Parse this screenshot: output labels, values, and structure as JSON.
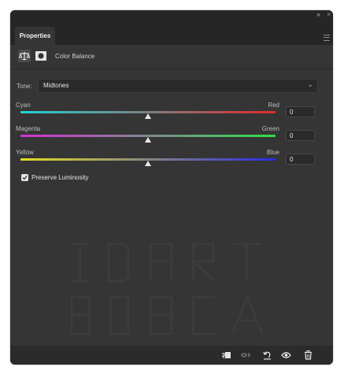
{
  "panel": {
    "tab_label": "Properties",
    "collapse_glyph": "«",
    "close_glyph": "×"
  },
  "header": {
    "adjustment_title": "Color Balance",
    "icons": [
      "balance-scale-icon",
      "layer-mask-icon"
    ]
  },
  "tone": {
    "label": "Tone:",
    "value": "Midtones",
    "chevron": "⌄"
  },
  "sliders": [
    {
      "left": "Cyan",
      "right": "Red",
      "value": "0",
      "fraction": 0.5,
      "colors": [
        "#1fd3d6",
        "#e02a2a"
      ]
    },
    {
      "left": "Magenta",
      "right": "Green",
      "value": "0",
      "fraction": 0.5,
      "colors": [
        "#d62fd6",
        "#2ee04a"
      ]
    },
    {
      "left": "Yellow",
      "right": "Blue",
      "value": "0",
      "fraction": 0.5,
      "colors": [
        "#e3e01f",
        "#2a2ae6"
      ]
    }
  ],
  "preserve_luminosity": {
    "label": "Preserve Luminosity",
    "checked": true
  },
  "bottom_toolbar": [
    "clip-to-layer-icon",
    "view-previous-state-icon",
    "reset-icon",
    "visibility-eye-icon",
    "trash-icon"
  ]
}
